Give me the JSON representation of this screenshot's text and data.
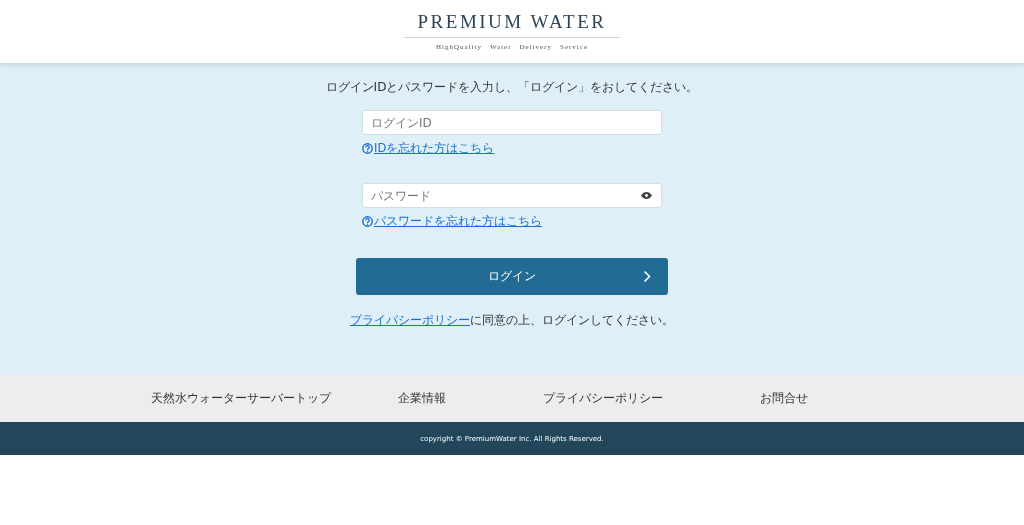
{
  "header": {
    "logo": "PREMIUM WATER",
    "tagline": "HighQuality　Water　Delivery　Service"
  },
  "login": {
    "instruction": "ログインIDとパスワードを入力し、「ログイン」をおしてください。",
    "id_field": {
      "placeholder": "ログインID"
    },
    "id_help": "IDを忘れた方はこちら",
    "password_field": {
      "placeholder": "パスワード"
    },
    "password_help": "パスワードを忘れた方はこちら",
    "login_button": "ログイン",
    "policy_link": "プライバシーポリシー",
    "policy_text": "に同意の上、ログインしてください。"
  },
  "footer": {
    "links": [
      "天然水ウォーターサーバートップ",
      "企業情報",
      "プライバシーポリシー",
      "お問合せ"
    ],
    "copyright": "copyright © PremiumWater Inc. All Rights Reserved."
  }
}
